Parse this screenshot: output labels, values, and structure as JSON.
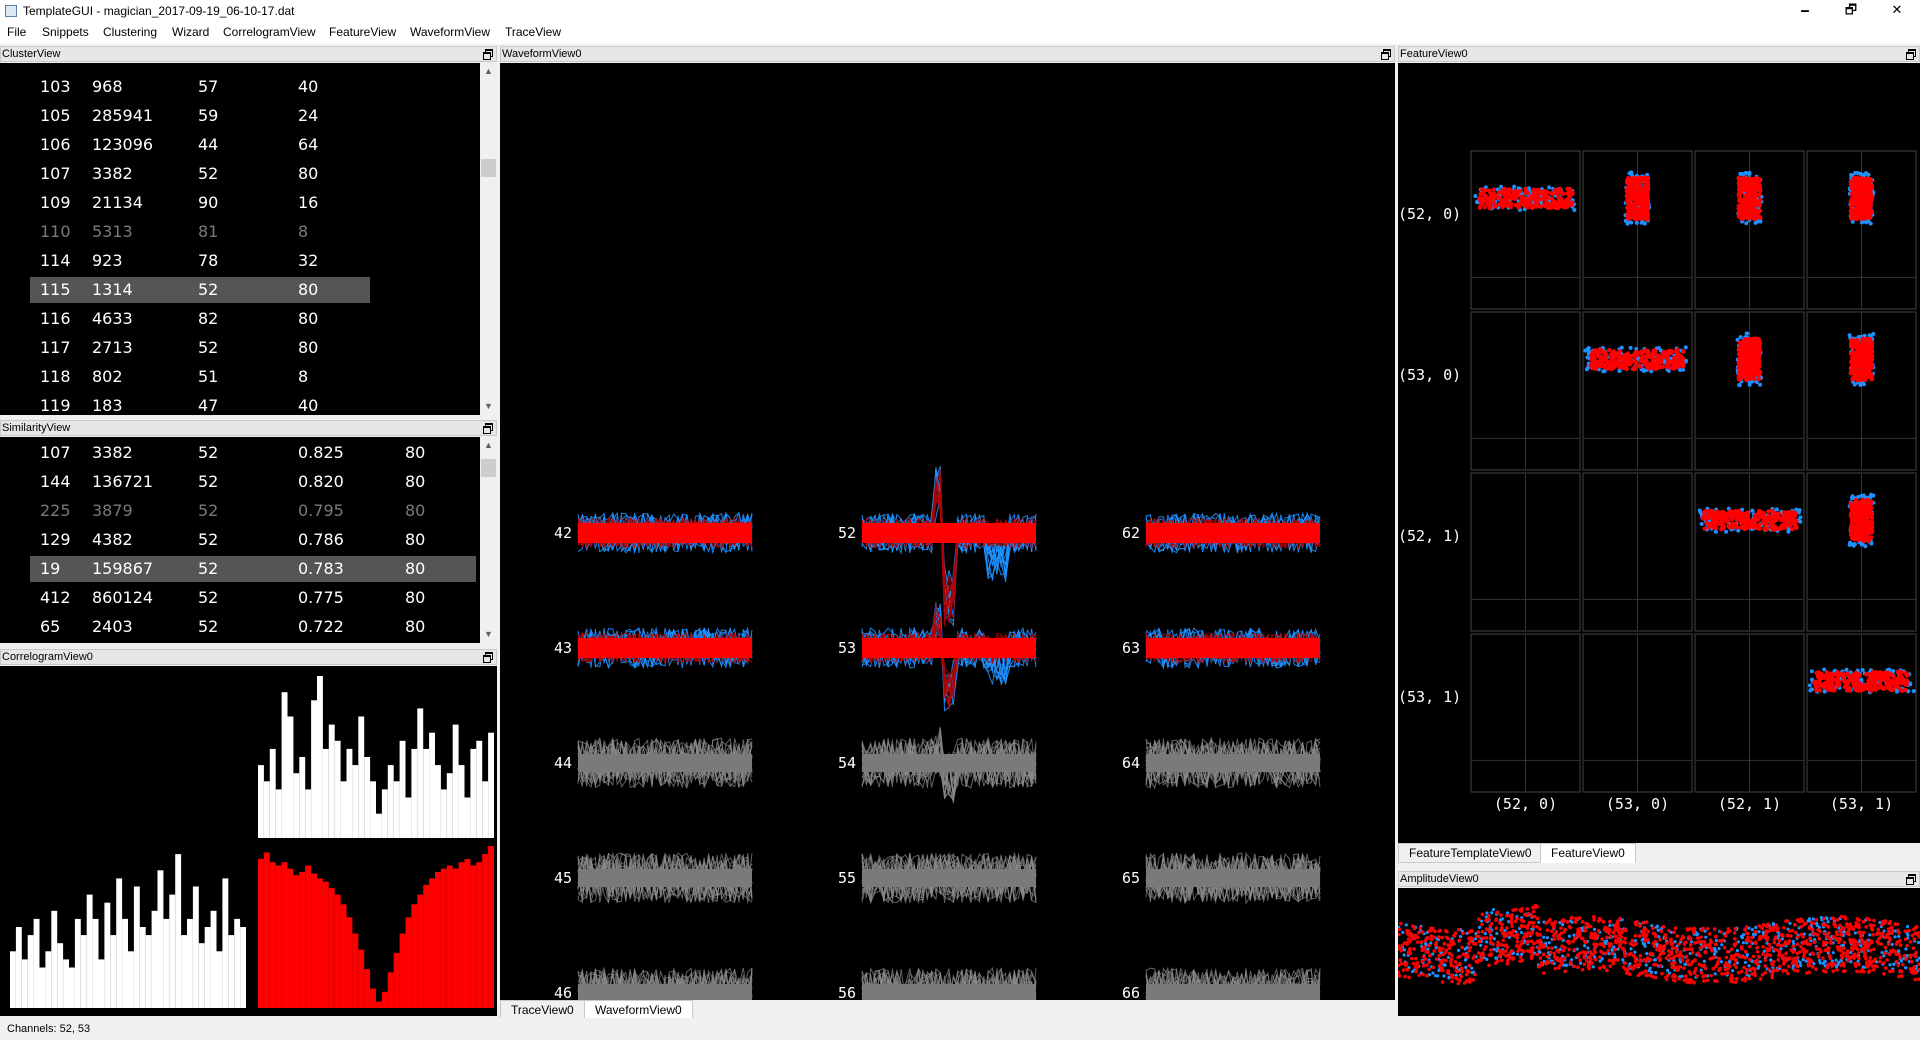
{
  "window": {
    "title": "TemplateGUI - magician_2017-09-19_06-10-17.dat",
    "minimize": "🗕",
    "maximize": "🗗",
    "close": "✕"
  },
  "menu": [
    "File",
    "Snippets",
    "Clustering",
    "Wizard",
    "CorrelogramView",
    "FeatureView",
    "WaveformView",
    "TraceView"
  ],
  "cluster_view": {
    "title": "ClusterView",
    "rows": [
      {
        "id": "103",
        "n": "968",
        "ch": "57",
        "amp": "40"
      },
      {
        "id": "105",
        "n": "285941",
        "ch": "59",
        "amp": "24"
      },
      {
        "id": "106",
        "n": "123096",
        "ch": "44",
        "amp": "64"
      },
      {
        "id": "107",
        "n": "3382",
        "ch": "52",
        "amp": "80"
      },
      {
        "id": "109",
        "n": "21134",
        "ch": "90",
        "amp": "16"
      },
      {
        "id": "110",
        "n": "5313",
        "ch": "81",
        "amp": "8",
        "dim": true
      },
      {
        "id": "114",
        "n": "923",
        "ch": "78",
        "amp": "32"
      },
      {
        "id": "115",
        "n": "1314",
        "ch": "52",
        "amp": "80",
        "selected": true
      },
      {
        "id": "116",
        "n": "4633",
        "ch": "82",
        "amp": "80"
      },
      {
        "id": "117",
        "n": "2713",
        "ch": "52",
        "amp": "80"
      },
      {
        "id": "118",
        "n": "802",
        "ch": "51",
        "amp": "8"
      },
      {
        "id": "119",
        "n": "183",
        "ch": "47",
        "amp": "40"
      }
    ]
  },
  "similarity_view": {
    "title": "SimilarityView",
    "rows": [
      {
        "id": "107",
        "n": "3382",
        "ch": "52",
        "sim": "0.825",
        "amp": "80"
      },
      {
        "id": "144",
        "n": "136721",
        "ch": "52",
        "sim": "0.820",
        "amp": "80"
      },
      {
        "id": "225",
        "n": "3879",
        "ch": "52",
        "sim": "0.795",
        "amp": "80",
        "dim": true
      },
      {
        "id": "129",
        "n": "4382",
        "ch": "52",
        "sim": "0.786",
        "amp": "80"
      },
      {
        "id": "19",
        "n": "159867",
        "ch": "52",
        "sim": "0.783",
        "amp": "80",
        "selected": true
      },
      {
        "id": "412",
        "n": "860124",
        "ch": "52",
        "sim": "0.775",
        "amp": "80"
      },
      {
        "id": "65",
        "n": "2403",
        "ch": "52",
        "sim": "0.722",
        "amp": "80"
      }
    ]
  },
  "correlogram_view": {
    "title": "CorrelogramView0",
    "bars_a": [
      0.45,
      0.35,
      0.55,
      0.3,
      0.9,
      0.75,
      0.4,
      0.5,
      0.3,
      0.85,
      1.0,
      0.55,
      0.7,
      0.6,
      0.35,
      0.55,
      0.45,
      0.75,
      0.5,
      0.35,
      0.15,
      0.3,
      0.45,
      0.35,
      0.6,
      0.25,
      0.55,
      0.8,
      0.55,
      0.65,
      0.45,
      0.3,
      0.4,
      0.7,
      0.45,
      0.25,
      0.55,
      0.6,
      0.35,
      0.65
    ],
    "bars_b": [
      0.35,
      0.5,
      0.3,
      0.45,
      0.55,
      0.25,
      0.35,
      0.6,
      0.4,
      0.3,
      0.25,
      0.55,
      0.45,
      0.7,
      0.55,
      0.3,
      0.65,
      0.45,
      0.8,
      0.55,
      0.35,
      0.75,
      0.5,
      0.45,
      0.6,
      0.85,
      0.55,
      0.7,
      0.95,
      0.45,
      0.55,
      0.75,
      0.4,
      0.5,
      0.6,
      0.35,
      0.8,
      0.45,
      0.55,
      0.5
    ],
    "bars_c": [
      0.92,
      0.96,
      0.9,
      0.88,
      0.9,
      0.86,
      0.82,
      0.84,
      0.88,
      0.83,
      0.8,
      0.78,
      0.74,
      0.7,
      0.64,
      0.56,
      0.46,
      0.36,
      0.24,
      0.12,
      0.04,
      0.1,
      0.22,
      0.34,
      0.46,
      0.56,
      0.64,
      0.7,
      0.76,
      0.8,
      0.84,
      0.86,
      0.88,
      0.86,
      0.9,
      0.92,
      0.88,
      0.9,
      0.95,
      1.0
    ],
    "bars_d": [
      0,
      0,
      0,
      0,
      0,
      0,
      0,
      0,
      0,
      0,
      0,
      0,
      0,
      0,
      0,
      0,
      0,
      0,
      0,
      0,
      0,
      0,
      0,
      0,
      0,
      0,
      0,
      0,
      0,
      0,
      0,
      0,
      0,
      0,
      0,
      0,
      0,
      0,
      0,
      0
    ]
  },
  "waveform_view": {
    "title": "WaveformView0",
    "channels": [
      [
        "42",
        "43",
        "44",
        "45",
        "46"
      ],
      [
        "52",
        "53",
        "54",
        "55",
        "56"
      ],
      [
        "62",
        "63",
        "64",
        "65",
        "66"
      ]
    ],
    "active_channels": [
      "42",
      "43",
      "52",
      "53",
      "62",
      "63"
    ],
    "tabs": [
      "TraceView0",
      "WaveformView0"
    ]
  },
  "feature_view": {
    "title": "FeatureView0",
    "row_labels": [
      "(52, 0)",
      "(53, 0)",
      "(52, 1)",
      "(53, 1)"
    ],
    "col_labels": [
      "(52, 0)",
      "(53, 0)",
      "(52, 1)",
      "(53, 1)"
    ],
    "tabs": [
      "FeatureTemplateView0",
      "FeatureView0"
    ]
  },
  "amplitude_view": {
    "title": "AmplitudeView0"
  },
  "status": "Channels: 52, 53",
  "colors": {
    "cluster_a": "#ff0000",
    "cluster_b": "#1e90ff",
    "background_channels": "#8c8c8c",
    "selection": "#555555"
  }
}
